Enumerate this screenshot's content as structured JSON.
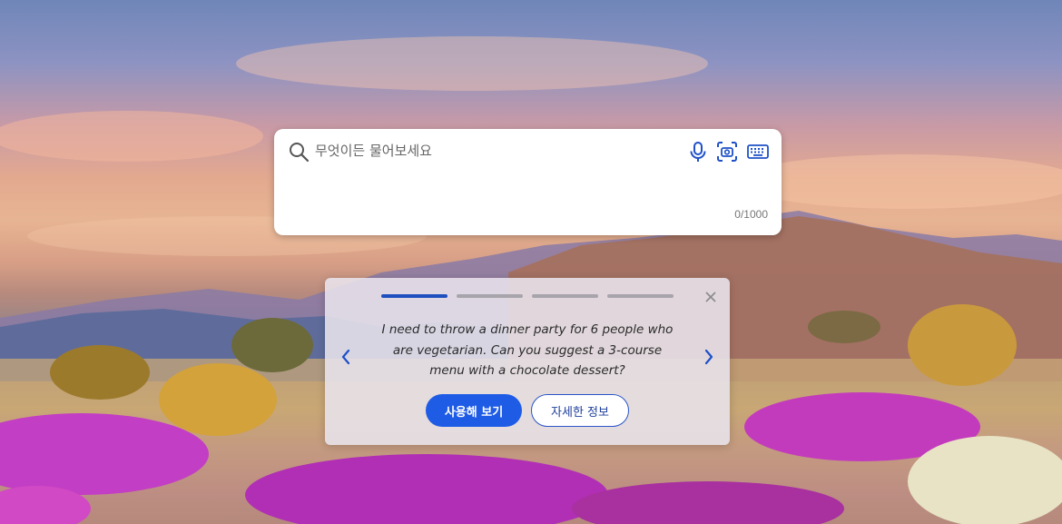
{
  "search": {
    "placeholder": "무엇이든 물어보세요",
    "value": "",
    "char_counter": "0/1000",
    "tools": [
      "microphone-icon",
      "visual-search-camera-icon",
      "keyboard-icon"
    ]
  },
  "suggestion_card": {
    "carousel": {
      "total_slides": 4,
      "active_slide": 1
    },
    "prompt_text": "I need to throw a dinner party for 6 people who are vegetarian. Can you suggest a 3-course menu with a chocolate dessert?",
    "try_button_label": "사용해 보기",
    "learn_more_button_label": "자세한 정보"
  },
  "colors": {
    "accent": "#1f5ce6",
    "active_segment": "#1f4fbf",
    "inactive_segment": "#a7a4ab",
    "icon_blue": "#1e50c8"
  }
}
